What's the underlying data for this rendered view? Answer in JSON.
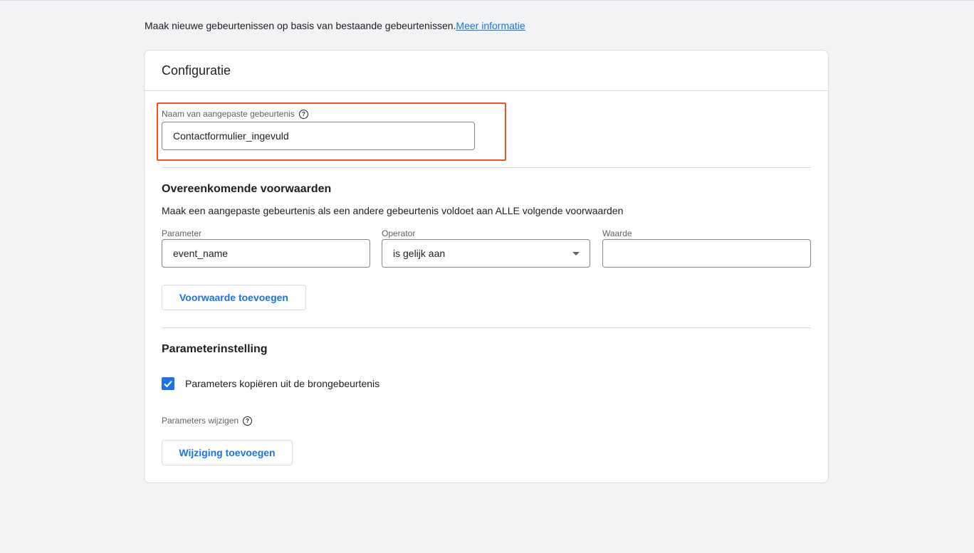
{
  "intro": {
    "text": "Maak nieuwe gebeurtenissen op basis van bestaande gebeurtenissen.",
    "link": "Meer informatie"
  },
  "card": {
    "title": "Configuratie",
    "custom_event": {
      "label": "Naam van aangepaste gebeurtenis",
      "value": "Contactformulier_ingevuld"
    },
    "conditions": {
      "title": "Overeenkomende voorwaarden",
      "description": "Maak een aangepaste gebeurtenis als een andere gebeurtenis voldoet aan ALLE volgende voorwaarden",
      "parameter_label": "Parameter",
      "parameter_value": "event_name",
      "operator_label": "Operator",
      "operator_value": "is gelijk aan",
      "value_label": "Waarde",
      "value_value": "",
      "add_condition_label": "Voorwaarde toevoegen"
    },
    "parameters": {
      "title": "Parameterinstelling",
      "copy_label": "Parameters kopiëren uit de brongebeurtenis",
      "copy_checked": true,
      "modify_label": "Parameters wijzigen",
      "add_modification_label": "Wijziging toevoegen"
    }
  },
  "colors": {
    "accent": "#1a73e8",
    "highlight": "#f4511e",
    "background": "#f1f3f4"
  },
  "icons": {
    "help": "help-circle-icon",
    "dropdown": "triangle-down-icon",
    "check": "checkmark-icon"
  }
}
